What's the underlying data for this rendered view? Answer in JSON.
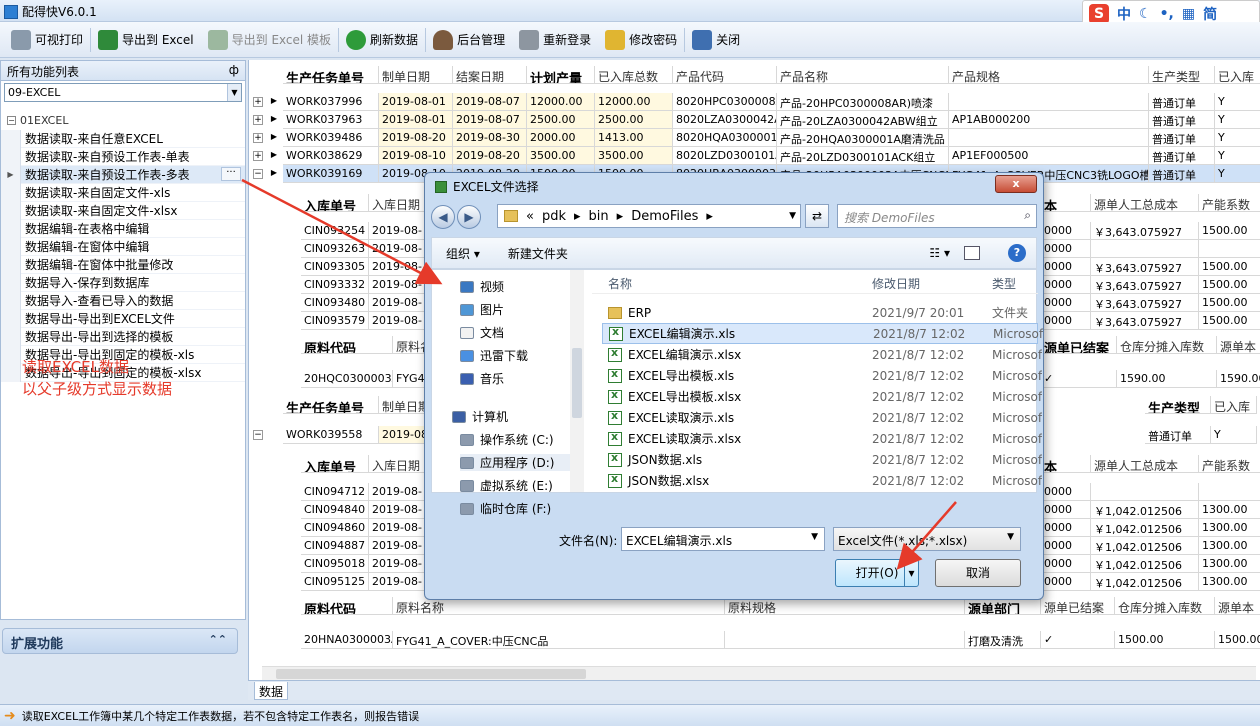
{
  "app": {
    "title": "配得快V6.0.1"
  },
  "ime": {
    "logo": "S",
    "label": "中",
    "icons": [
      "moon-icon",
      "dot-icon",
      "keyboard-icon"
    ],
    "trad": "简"
  },
  "toolbar": {
    "print": "可视打印",
    "export": "导出到 Excel",
    "export_tpl": "导出到 Excel 模板",
    "refresh": "刷新数据",
    "admin": "后台管理",
    "relogin": "重新登录",
    "changepw": "修改密码",
    "close": "关闭"
  },
  "left": {
    "title": "所有功能列表",
    "pin": "ф",
    "combo": "09-EXCEL",
    "group": "01EXCEL",
    "items": [
      "数据读取-来自任意EXCEL",
      "数据读取-来自预设工作表-单表",
      "数据读取-来自预设工作表-多表",
      "数据读取-来自固定文件-xls",
      "数据读取-来自固定文件-xlsx",
      "数据编辑-在表格中编辑",
      "数据编辑-在窗体中编辑",
      "数据编辑-在窗体中批量修改",
      "数据导入-保存到数据库",
      "数据导入-查看已导入的数据",
      "数据导出-导出到EXCEL文件",
      "数据导出-导出到选择的模板",
      "数据导出-导出到固定的模板-xls",
      "数据导出-导出到固定的模板-xlsx"
    ],
    "more": "···",
    "note1": "读取EXCEL数据",
    "note2": "以父子级方式显示数据",
    "ext": "扩展功能",
    "ext_chev": "≈"
  },
  "grid": {
    "h1": [
      "生产任务单号",
      "制单日期",
      "结案日期",
      "计划产量",
      "已入库总数",
      "产品代码",
      "产品名称",
      "产品规格",
      "生产类型",
      "已入库"
    ],
    "rows1": [
      [
        "WORK037996",
        "2019-08-01",
        "2019-08-07",
        "12000.00",
        "12000.00",
        "8020HPC0300008A",
        "产品-20HPC0300008AR)喷漆",
        "",
        "普通订单",
        "Y"
      ],
      [
        "WORK037963",
        "2019-08-01",
        "2019-08-07",
        "2500.00",
        "2500.00",
        "8020LZA0300042A",
        "产品-20LZA0300042ABW组立",
        "AP1AB000200",
        "普通订单",
        "Y"
      ],
      [
        "WORK039486",
        "2019-08-20",
        "2019-08-30",
        "2000.00",
        "1413.00",
        "8020HQA0300001A",
        "产品-20HQA0300001A磨清洗品",
        "",
        "普通订单",
        "Y"
      ],
      [
        "WORK038629",
        "2019-08-10",
        "2019-08-20",
        "3500.00",
        "3500.00",
        "8020LZD0300101A",
        "产品-20LZD0300101ACK组立",
        "AP1EF000500",
        "普通订单",
        "Y"
      ],
      [
        "WORK039169",
        "2019-08-10",
        "2019-08-20",
        "1500.00",
        "1500.00",
        "8020HRA0300003A",
        "产品-20HRA0300003A中压CNC3铣LOGO槽品",
        "FYG41_A_COVER中压CNC3铣LOGO槽品",
        "普通订单",
        "Y"
      ]
    ],
    "h2": [
      "入库单号",
      "入库日期",
      "源单人工总成本",
      "产能系数"
    ],
    "rows2": [
      [
        "CIN093254",
        "2019-08-",
        "￥3,643.075927",
        "1500.00"
      ],
      [
        "CIN093263",
        "2019-08-",
        "",
        ""
      ],
      [
        "CIN093305",
        "2019-08-",
        "￥3,643.075927",
        "1500.00"
      ],
      [
        "CIN093332",
        "2019-08-",
        "￥3,643.075927",
        "1500.00"
      ],
      [
        "CIN093480",
        "2019-08-",
        "￥3,643.075927",
        "1500.00"
      ],
      [
        "CIN093579",
        "2019-08-",
        "￥3,643.075927",
        "1500.00"
      ]
    ],
    "h3": [
      "原料代码",
      "原料名称",
      "源单已结案",
      "仓库分摊入库数",
      "源单本"
    ],
    "r3": [
      "20HQC0300003A",
      "FYG41",
      "✓",
      "1590.00",
      "1590.00"
    ],
    "h4": [
      "生产任务单号",
      "制单日期",
      "生产类型",
      "已入库"
    ],
    "r4": [
      "WORK039558",
      "2019-08-",
      "普通订单",
      "Y"
    ],
    "rows5": [
      [
        "CIN094712",
        "2019-08-",
        "",
        ""
      ],
      [
        "CIN094840",
        "2019-08-",
        "￥1,042.012506",
        "1300.00"
      ],
      [
        "CIN094860",
        "2019-08-",
        "￥1,042.012506",
        "1300.00"
      ],
      [
        "CIN094887",
        "2019-08-",
        "￥1,042.012506",
        "1300.00"
      ],
      [
        "CIN095018",
        "2019-08-",
        "￥1,042.012506",
        "1300.00"
      ],
      [
        "CIN095125",
        "2019-08-",
        "￥1,042.012506",
        "1300.00"
      ]
    ],
    "h6": [
      "原料代码",
      "原料名称",
      "原料规格",
      "源单部门",
      "源单已结案",
      "仓库分摊入库数",
      "源单本"
    ],
    "r6": [
      "20HNA0300003A",
      "FYG41_A_COVER:中压CNC品",
      "",
      "打磨及清洗",
      "✓",
      "1500.00",
      "1500.00"
    ],
    "tab": "数据",
    "h2b": "本",
    "plus": "+",
    "minus": "−",
    "arrow": "▶"
  },
  "status": {
    "text": "读取EXCEL工作簿中某几个特定工作表数据，若不包含特定工作表名，则报告错误"
  },
  "dialog": {
    "title": "EXCEL文件选择",
    "close": "x",
    "back": "◀",
    "fwd": "▶",
    "path": [
      "«",
      "pdk",
      "bin",
      "DemoFiles"
    ],
    "search": "搜索 DemoFiles",
    "organize": "组织 ▾",
    "newfolder": "新建文件夹",
    "nav": [
      "视频",
      "图片",
      "文档",
      "迅雷下载",
      "音乐",
      "计算机",
      "操作系统 (C:)",
      "应用程序 (D:)",
      "虚拟系统 (E:)",
      "临时仓库 (F:)"
    ],
    "cols": [
      "名称",
      "修改日期",
      "类型"
    ],
    "files": [
      {
        "name": "ERP",
        "date": "2021/9/7 20:01",
        "type": "文件夹",
        "folder": true
      },
      {
        "name": "EXCEL编辑演示.xls",
        "date": "2021/8/7 12:02",
        "type": "Microsoft"
      },
      {
        "name": "EXCEL编辑演示.xlsx",
        "date": "2021/8/7 12:02",
        "type": "Microsoft"
      },
      {
        "name": "EXCEL导出模板.xls",
        "date": "2021/8/7 12:02",
        "type": "Microsoft"
      },
      {
        "name": "EXCEL导出模板.xlsx",
        "date": "2021/8/7 12:02",
        "type": "Microsoft"
      },
      {
        "name": "EXCEL读取演示.xls",
        "date": "2021/8/7 12:02",
        "type": "Microsoft"
      },
      {
        "name": "EXCEL读取演示.xlsx",
        "date": "2021/8/7 12:02",
        "type": "Microsoft"
      },
      {
        "name": "JSON数据.xls",
        "date": "2021/8/7 12:02",
        "type": "Microsoft"
      },
      {
        "name": "JSON数据.xlsx",
        "date": "2021/8/7 12:02",
        "type": "Microsoft"
      }
    ],
    "filename_label": "文件名(N):",
    "filename": "EXCEL编辑演示.xls",
    "filter": "Excel文件(*.xls;*.xlsx)",
    "open": "打开(O)",
    "cancel": "取消"
  }
}
